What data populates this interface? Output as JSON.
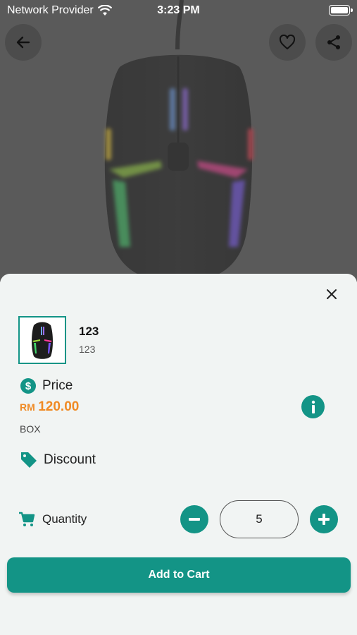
{
  "status_bar": {
    "carrier": "Network Provider",
    "time": "3:23 PM"
  },
  "nav": {
    "back_icon": "arrow-left-icon",
    "favorite_icon": "heart-outline-icon",
    "share_icon": "share-icon"
  },
  "product": {
    "image": "gaming-mouse-rgb",
    "name": "123",
    "code": "123"
  },
  "price": {
    "label": "Price",
    "currency": "RM",
    "amount": "120.00",
    "uom": "BOX"
  },
  "discount": {
    "label": "Discount"
  },
  "quantity": {
    "label": "Quantity",
    "value": "5"
  },
  "actions": {
    "add_to_cart": "Add to Cart"
  },
  "colors": {
    "accent": "#139486",
    "price": "#f08a24"
  }
}
